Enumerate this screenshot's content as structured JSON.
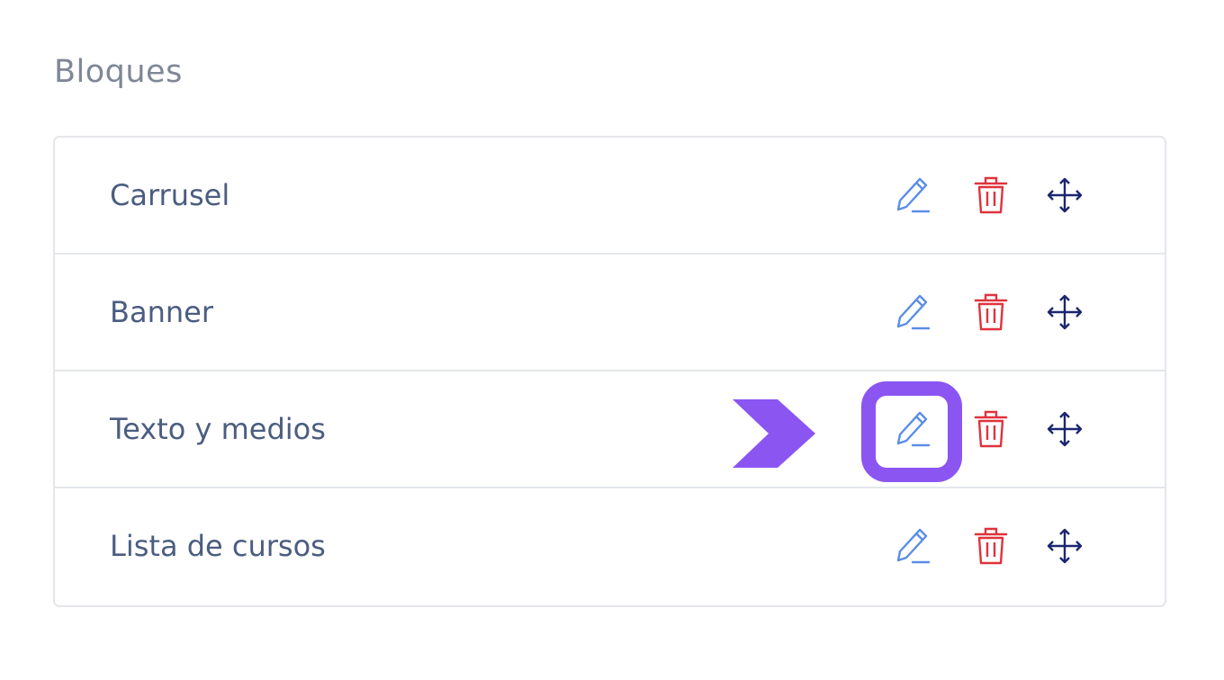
{
  "section": {
    "title": "Bloques"
  },
  "blocks": [
    {
      "name": "Carrusel"
    },
    {
      "name": "Banner"
    },
    {
      "name": "Texto y medios"
    },
    {
      "name": "Lista de cursos"
    }
  ],
  "icons": {
    "edit": "pencil-icon",
    "delete": "trash-icon",
    "move": "move-arrows-icon",
    "pointer": "chevron-right-arrow-icon"
  },
  "colors": {
    "edit": "#5b8de8",
    "delete": "#e0323d",
    "move": "#1c2670",
    "highlight": "#8b55f2",
    "text": "#4b5d80",
    "title": "#7f8796",
    "border": "#e4e6ea"
  }
}
